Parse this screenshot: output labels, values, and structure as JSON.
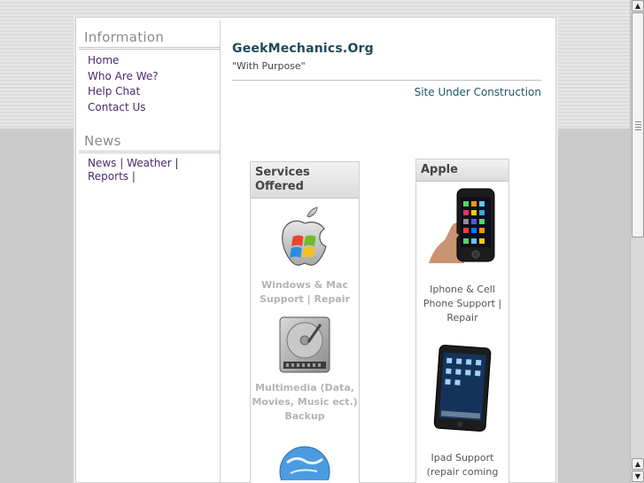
{
  "sidebar": {
    "information_heading": "Information",
    "links": [
      "Home",
      "Who Are We?",
      "Help Chat",
      "Contact Us"
    ],
    "news_heading": "News",
    "news_links": "News | Weather | Reports |"
  },
  "header": {
    "site_title": "GeekMechanics.Org",
    "tagline": "\"With Purpose\"",
    "status": "Site Under Construction"
  },
  "services": {
    "heading": "Services Offered",
    "items": [
      {
        "icon": "windows-apple-icon",
        "caption": "Windows & Mac Support | Repair"
      },
      {
        "icon": "hard-drive-icon",
        "caption": "Multimedia (Data, Movies, Music ect.) Backup"
      },
      {
        "icon": "globe-icon",
        "caption": ""
      }
    ]
  },
  "apple": {
    "heading": "Apple",
    "items": [
      {
        "icon": "iphone-icon",
        "caption": "Iphone & Cell Phone Support | Repair"
      },
      {
        "icon": "ipad-icon",
        "caption": "Ipad Support (repair coming"
      }
    ]
  },
  "scrollbar": {
    "up_arrow": "▲",
    "down_arrow": "▼"
  }
}
